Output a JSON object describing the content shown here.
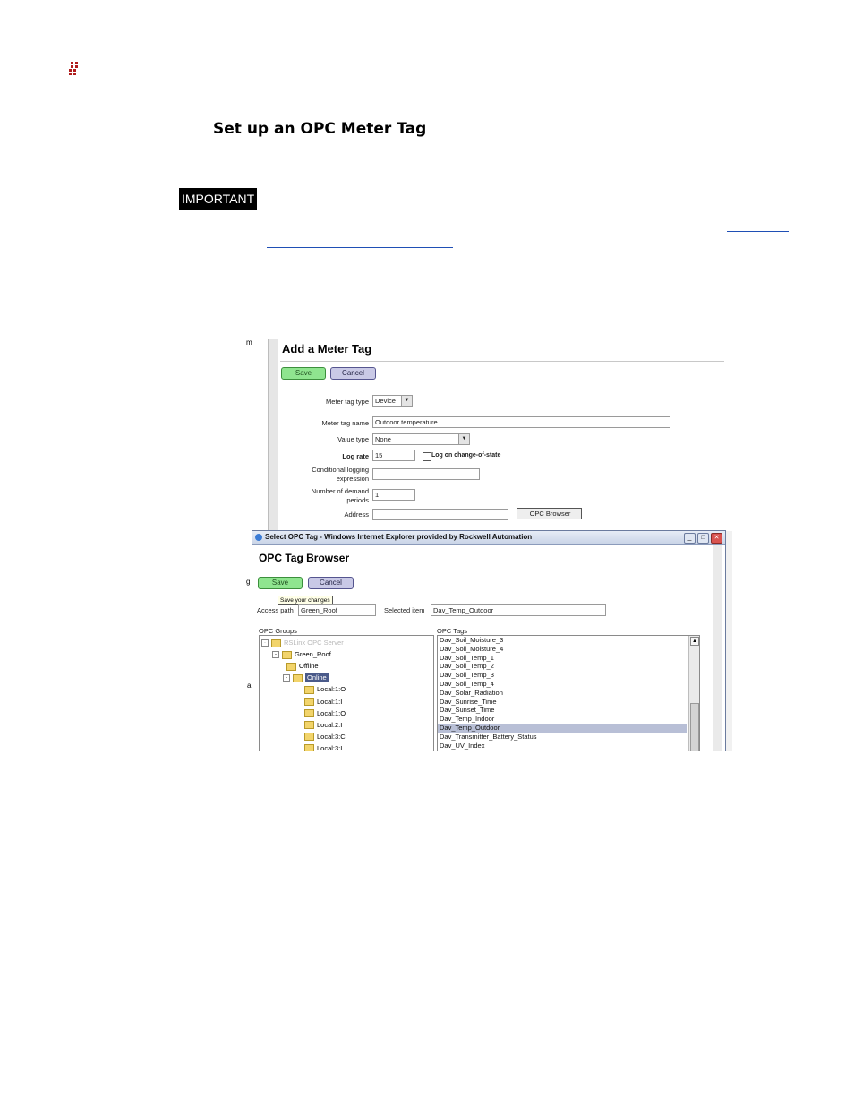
{
  "heading": "Set up an OPC Meter Tag",
  "important_label": "IMPORTANT",
  "screenshot": {
    "left_fragments": {
      "m": "m",
      "g": "g",
      "a": "a"
    },
    "add_tag": {
      "title": "Add a Meter Tag",
      "save": "Save",
      "cancel": "Cancel",
      "labels": {
        "tag_type": "Meter tag type",
        "tag_name": "Meter tag name",
        "value_type": "Value type",
        "log_rate": "Log rate",
        "cond_logging_1": "Conditional logging",
        "cond_logging_2": "expression",
        "demand_1": "Number of demand",
        "demand_2": "periods",
        "address": "Address"
      },
      "values": {
        "tag_type": "Device",
        "tag_name": "Outdoor temperature",
        "value_type": "None",
        "log_rate": "15",
        "demand": "1",
        "conditional": "",
        "address": ""
      },
      "log_change_label": "Log on change-of-state",
      "opc_browser_button": "OPC Browser"
    },
    "dialog": {
      "window_title": "Select OPC Tag - Windows Internet Explorer provided by Rockwell Automation",
      "title": "OPC Tag Browser",
      "save": "Save",
      "cancel": "Cancel",
      "tooltip": "Save your changes",
      "access_path_label": "Access path",
      "access_path_value": "Green_Roof",
      "selected_item_label": "Selected item",
      "selected_item_value": "Dav_Temp_Outdoor",
      "groups_label": "OPC Groups",
      "tags_label": "OPC Tags",
      "tree": [
        {
          "label": "RSLinx OPC Server",
          "expander": "-"
        },
        {
          "label": "Green_Roof",
          "expander": "-"
        },
        {
          "label": "Offline",
          "expander": ""
        },
        {
          "label": "Online",
          "expander": "-"
        },
        {
          "label": "Local:1:O",
          "expander": ""
        },
        {
          "label": "Local:1:I",
          "expander": ""
        },
        {
          "label": "Local:1:O",
          "expander": ""
        },
        {
          "label": "Local:2:I",
          "expander": ""
        },
        {
          "label": "Local:3:C",
          "expander": ""
        },
        {
          "label": "Local:3:I",
          "expander": ""
        }
      ],
      "tags": [
        "Dav_Soil_Moisture_3",
        "Dav_Soil_Moisture_4",
        "Dav_Soil_Temp_1",
        "Dav_Soil_Temp_2",
        "Dav_Soil_Temp_3",
        "Dav_Soil_Temp_4",
        "Dav_Solar_Radiation",
        "Dav_Sunrise_Time",
        "Dav_Sunset_Time",
        "Dav_Temp_Indoor",
        "Dav_Temp_Outdoor",
        "Dav_Transmitter_Battery_Status",
        "Dav_UV_Index"
      ],
      "selected_tag_index": 10
    }
  }
}
